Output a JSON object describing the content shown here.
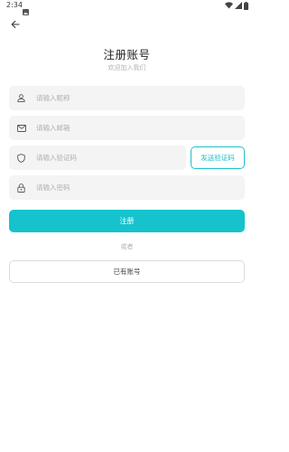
{
  "status_bar": {
    "time": "2:34",
    "icons": [
      "image-icon",
      "wifi-icon",
      "signal-icon",
      "battery-icon"
    ]
  },
  "header": {
    "back_icon": "arrow-left-icon"
  },
  "title": "注册账号",
  "subtitle": "欢迎加入我们",
  "form": {
    "name": {
      "placeholder": "请输入昵称",
      "value": "",
      "icon": "user-icon"
    },
    "email": {
      "placeholder": "请输入邮箱",
      "value": "",
      "icon": "mail-icon"
    },
    "code": {
      "placeholder": "请输入验证码",
      "value": "",
      "icon": "shield-icon"
    },
    "send_code_label": "发送验证码",
    "password": {
      "placeholder": "请输入密码",
      "value": "",
      "icon": "lock-icon"
    }
  },
  "register_label": "注册",
  "or_label": "或者",
  "login_label": "已有账号",
  "colors": {
    "accent": "#16c3cc",
    "field_bg": "#f4f4f4",
    "placeholder": "#b0b0b0"
  }
}
